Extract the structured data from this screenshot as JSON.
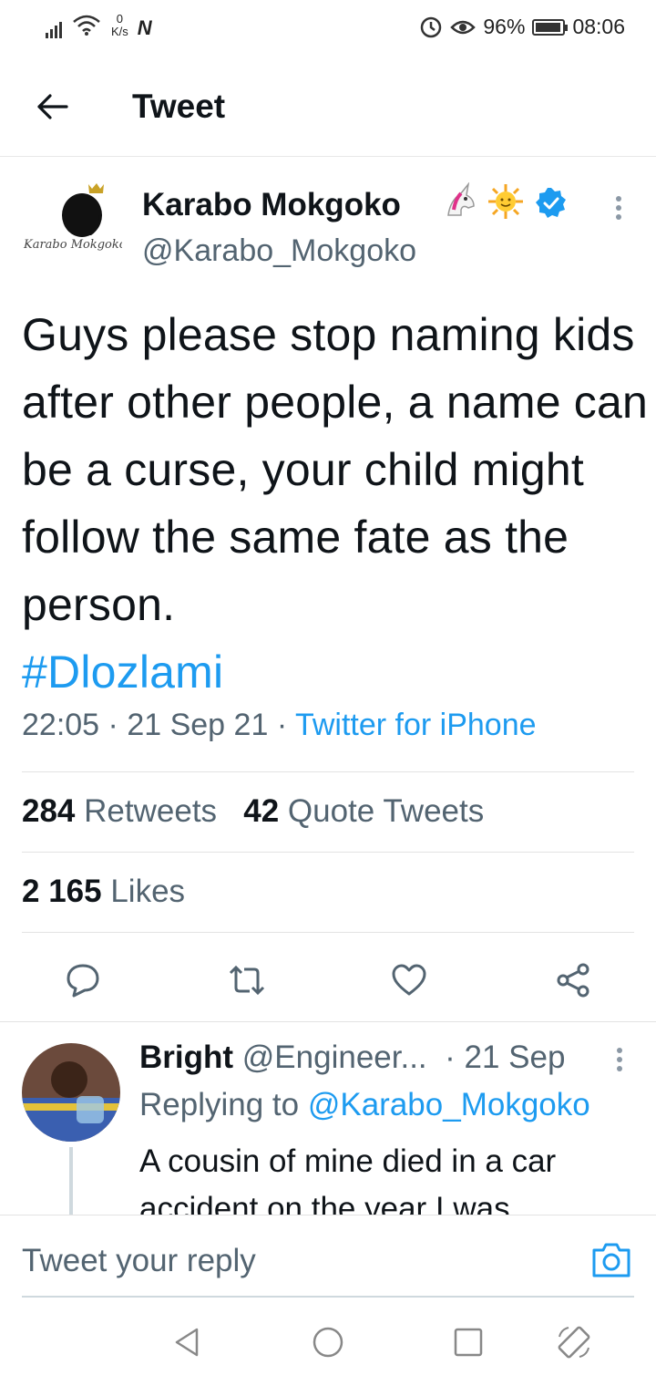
{
  "status_bar": {
    "speed_value": "0",
    "speed_unit": "K/s",
    "nfc": "N",
    "battery": "96%",
    "time": "08:06"
  },
  "header": {
    "title": "Tweet"
  },
  "tweet": {
    "author_name": "Karabo Mokgoko",
    "author_handle": "@Karabo_Mokgoko",
    "avatar_text": "Karabo Mokgoko",
    "text": "Guys please stop naming kids after other people, a name can be a curse, your child might follow the same fate as the person.",
    "hashtag": "#Dlozlami",
    "time": "22:05",
    "date": "21 Sep 21",
    "source": "Twitter for iPhone",
    "retweets_count": "284",
    "retweets_label": "Retweets",
    "quotes_count": "42",
    "quotes_label": "Quote Tweets",
    "likes_count": "2 165",
    "likes_label": "Likes"
  },
  "reply": {
    "name": "Bright",
    "handle": "@Engineer...",
    "date": "· 21 Sep",
    "replying_prefix": "Replying to",
    "replying_to": "@Karabo_Mokgoko",
    "text": "A cousin of mine died in a car accident on the year I was"
  },
  "compose": {
    "placeholder": "Tweet your reply"
  },
  "colors": {
    "accent": "#1d9bf0",
    "secondary_text": "#536471",
    "primary_text": "#0f1419"
  }
}
